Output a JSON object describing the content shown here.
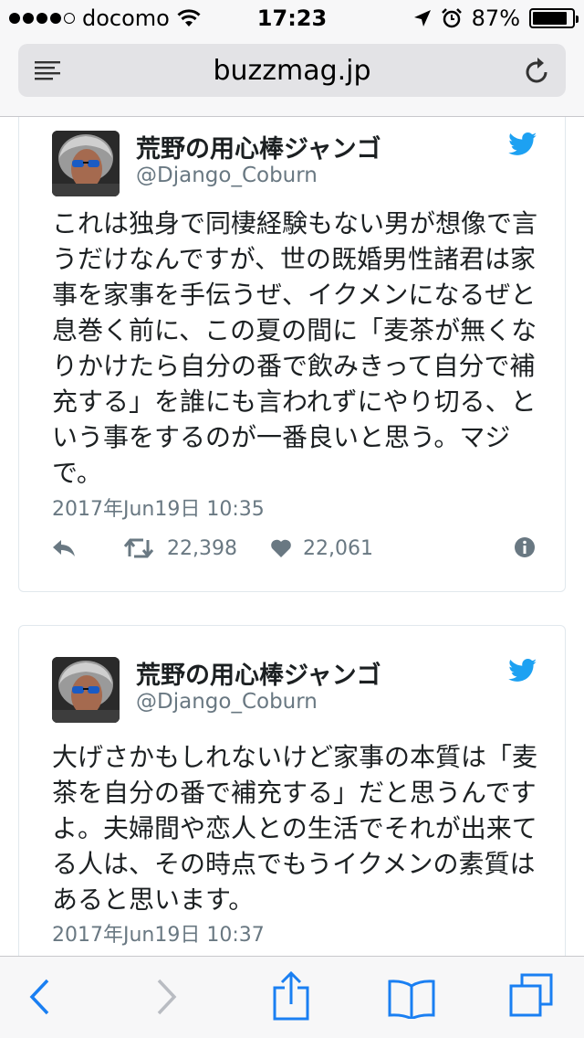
{
  "status_bar": {
    "carrier": "docomo",
    "time": "17:23",
    "battery": "87%",
    "battery_level": 0.87
  },
  "browser": {
    "url": "buzzmag.jp"
  },
  "tweets": [
    {
      "name": "荒野の用心棒ジャンゴ",
      "handle": "@Django_Coburn",
      "text": "これは独身で同棲経験もない男が想像で言うだけなんですが、世の既婚男性諸君は家事を家事を手伝うぜ、イクメンになるぜと息巻く前に、この夏の間に「麦茶が無くなりかけたら自分の番で飲みきって自分で補充する」を誰にも言われずにやり切る、という事をするのが一番良いと思う。マジで。",
      "timestamp": "2017年Jun19日 10:35",
      "retweets": "22,398",
      "likes": "22,061"
    },
    {
      "name": "荒野の用心棒ジャンゴ",
      "handle": "@Django_Coburn",
      "text": "大げさかもしれないけど家事の本質は「麦茶を自分の番で補充する」だと思うんですよ。夫婦間や恋人との生活でそれが出来てる人は、その時点でもうイクメンの素質はあると思います。",
      "timestamp": "2017年Jun19日 10:37"
    }
  ],
  "colors": {
    "ios_blue": "#1a7ff2",
    "twitter_blue": "#1da1f2",
    "meta_gray": "#697882"
  }
}
